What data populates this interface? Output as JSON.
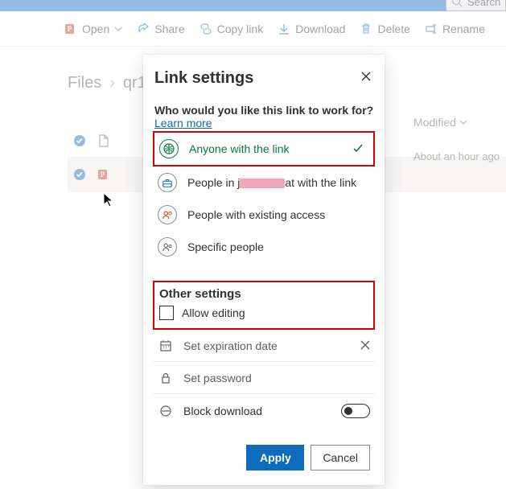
{
  "searchbar": {
    "placeholder": "Search"
  },
  "commandbar": {
    "open": "Open",
    "share": "Share",
    "copylink": "Copy link",
    "download": "Download",
    "delete": "Delete",
    "rename": "Rename"
  },
  "breadcrumb": {
    "root": "Files",
    "current": "qr1"
  },
  "listheader": {
    "modified": "Modified"
  },
  "file": {
    "modified": "About an hour ago"
  },
  "dialog": {
    "title": "Link settings",
    "subhead": "Who would you like this link to work for?",
    "learnmore": "Learn more",
    "options": {
      "anyone": "Anyone with the link",
      "org_prefix": "People in j",
      "org_suffix": "at with the link",
      "existing": "People with existing access",
      "specific": "Specific people"
    },
    "other_settings_title": "Other settings",
    "allow_editing": "Allow editing",
    "expiration_placeholder": "Set expiration date",
    "password_placeholder": "Set password",
    "block_download": "Block download",
    "apply": "Apply",
    "cancel": "Cancel"
  }
}
